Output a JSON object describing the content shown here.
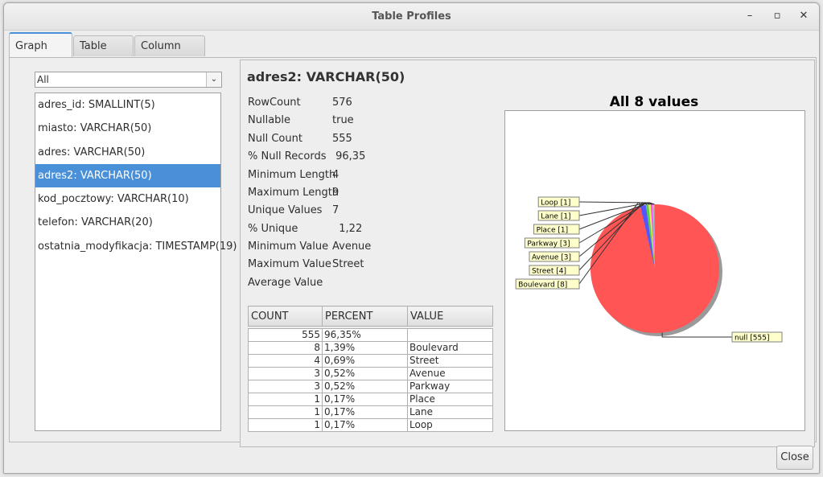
{
  "window": {
    "title": "Table Profiles"
  },
  "tabs": [
    "Graph View",
    "Table View",
    "Column View"
  ],
  "filter": {
    "selected": "All"
  },
  "columns": [
    "adres_id: SMALLINT(5)",
    "miasto: VARCHAR(50)",
    "adres: VARCHAR(50)",
    "adres2: VARCHAR(50)",
    "kod_pocztowy: VARCHAR(10)",
    "telefon: VARCHAR(20)",
    "ostatnia_modyfikacja: TIMESTAMP(19)"
  ],
  "details": {
    "title": "adres2: VARCHAR(50)",
    "stats": [
      {
        "k": "RowCount",
        "v": "576"
      },
      {
        "k": "Nullable",
        "v": "true"
      },
      {
        "k": "Null Count",
        "v": "555"
      },
      {
        "k": "% Null Records",
        "v": " 96,35"
      },
      {
        "k": "Minimum Length",
        "v": "4"
      },
      {
        "k": "Maximum Length",
        "v": "9"
      },
      {
        "k": "Unique Values",
        "v": "7"
      },
      {
        "k": "% Unique",
        "v": "  1,22"
      },
      {
        "k": "Minimum Value",
        "v": "Avenue"
      },
      {
        "k": "Maximum Value",
        "v": "Street"
      },
      {
        "k": "Average Value",
        "v": ""
      }
    ],
    "table": {
      "headers": [
        "COUNT",
        "PERCENT",
        "VALUE"
      ],
      "rows": [
        [
          "555",
          "96,35%",
          ""
        ],
        [
          "8",
          "1,39%",
          "Boulevard"
        ],
        [
          "4",
          "0,69%",
          "Street"
        ],
        [
          "3",
          "0,52%",
          "Avenue"
        ],
        [
          "3",
          "0,52%",
          "Parkway"
        ],
        [
          "1",
          "0,17%",
          "Place"
        ],
        [
          "1",
          "0,17%",
          "Lane"
        ],
        [
          "1",
          "0,17%",
          "Loop"
        ]
      ]
    }
  },
  "chart_data": {
    "type": "pie",
    "title": "All 8 values",
    "slices": [
      {
        "label": "null [555]",
        "value": 555,
        "color": "#ff5555"
      },
      {
        "label": "Boulevard [8]",
        "value": 8,
        "color": "#5555ff"
      },
      {
        "label": "Street [4]",
        "value": 4,
        "color": "#55cc55"
      },
      {
        "label": "Avenue [3]",
        "value": 3,
        "color": "#eeee55"
      },
      {
        "label": "Parkway [3]",
        "value": 3,
        "color": "#ff55ff"
      },
      {
        "label": "Place [1]",
        "value": 1,
        "color": "#55ffff"
      },
      {
        "label": "Lane [1]",
        "value": 1,
        "color": "#ff8a8a"
      },
      {
        "label": "Loop [1]",
        "value": 1,
        "color": "#a0a0a0"
      }
    ]
  },
  "footer": {
    "close_label": "Close"
  }
}
